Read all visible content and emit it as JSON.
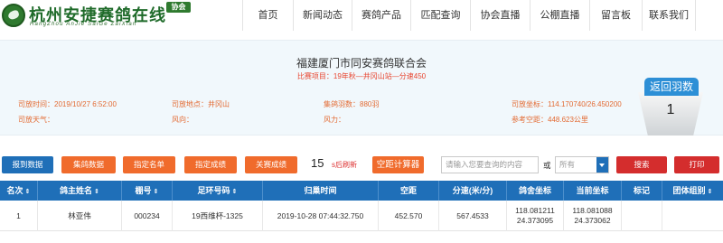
{
  "header": {
    "logo_title": "杭州安捷赛鸽在线",
    "logo_sub": "HangZhou AnJie SaiGe ZaiXian",
    "logo_badge": "协会",
    "nav": [
      "首页",
      "新闻动态",
      "赛鸽产品",
      "匹配查询",
      "协会直播",
      "公棚直播",
      "留言板",
      "联系我们"
    ]
  },
  "race": {
    "org": "福建厦门市同安赛鸽联合会",
    "project": "比赛项目：19年秋—井冈山站—分速450",
    "release_time_label": "司放时间：",
    "release_time": "2019/10/27 6:52:00",
    "release_place_label": "司放地点：",
    "release_place": "井冈山",
    "gather_label": "集鸽羽数：",
    "gather": "880羽",
    "coord_label": "司放坐标：",
    "coord": "114.170740/26.450200",
    "weather_label": "司放天气：",
    "weather": "",
    "wind_dir_label": "风向：",
    "wind_dir": "",
    "wind_force_label": "风力：",
    "wind_force": "",
    "distance_label": "参考空距：",
    "distance": "448.623公里"
  },
  "return_box": {
    "title": "返回羽数",
    "count": "1"
  },
  "toolbar": {
    "btn_report": "报到数据",
    "btn_gather": "集鸽数据",
    "btn_list": "指定名单",
    "btn_result": "指定成绩",
    "btn_focus": "关赛成绩",
    "refresh_count": "15",
    "refresh_text": "s后刷新",
    "btn_calc": "空距计算器",
    "search_placeholder": "请输入您要查询的内容",
    "or_label": "或",
    "select_value": "所有",
    "btn_search": "搜索",
    "btn_print": "打印"
  },
  "table": {
    "headers": [
      "名次",
      "鸽主姓名",
      "棚号",
      "足环号码",
      "归巢时间",
      "空距",
      "分速(米/分)",
      "鸽舍坐标",
      "当前坐标",
      "标记",
      "团体组别"
    ],
    "rows": [
      {
        "rank": "1",
        "name": "林亚伟",
        "loft": "000234",
        "ring": "19西维杯-1325",
        "time": "2019-10-28 07:44:32.750",
        "distance": "452.570",
        "speed": "567.4533",
        "home_coord_1": "118.081211",
        "home_coord_2": "24.373095",
        "cur_coord_1": "118.081088",
        "cur_coord_2": "24.373062",
        "mark": "",
        "group": ""
      }
    ]
  },
  "colors": {
    "brand_green": "#1f6b2a",
    "primary_blue": "#1f6fb8",
    "accent_orange": "#f06b2c",
    "accent_red": "#d42d2d"
  }
}
